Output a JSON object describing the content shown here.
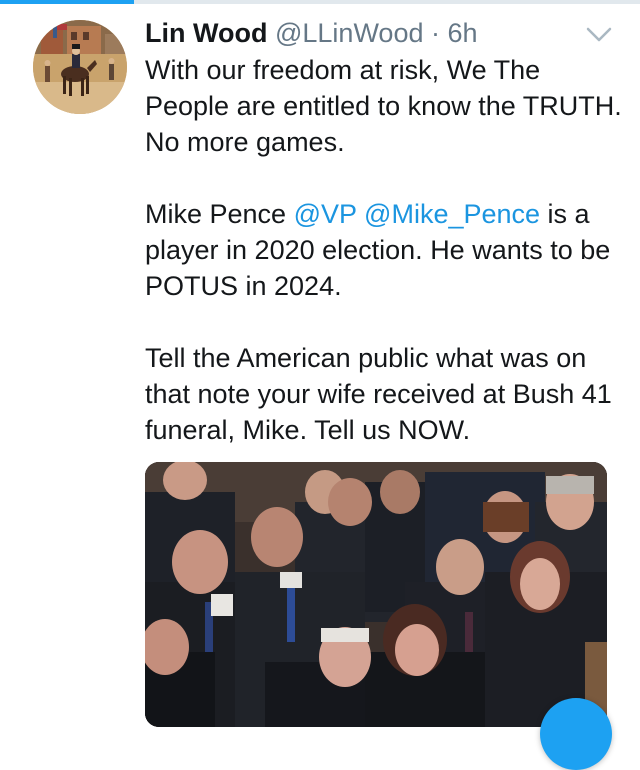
{
  "progress": {
    "fraction": 0.21
  },
  "tweet": {
    "display_name": "Lin Wood",
    "handle": "@LLinWood",
    "separator": "·",
    "time": "6h",
    "paragraphs": [
      [
        {
          "text": "With our freedom at risk, We The People are entitled to know the TRUTH. No more games."
        }
      ],
      [
        {
          "text": "Mike Pence "
        },
        {
          "text": "@VP",
          "mention": true
        },
        {
          "text": " "
        },
        {
          "text": "@Mike_Pence",
          "mention": true
        },
        {
          "text": " is a player in 2020 election. He wants to be POTUS in 2024."
        }
      ],
      [
        {
          "text": "Tell the American public what was on that note your wife received at Bush 41 funeral, Mike. Tell us NOW."
        }
      ]
    ]
  },
  "icons": {
    "caret": "chevron-down-icon",
    "compose": "compose-tweet-icon"
  },
  "colors": {
    "accent": "#1da1f2",
    "mention": "#1b95e0",
    "secondary_text": "#657786"
  }
}
